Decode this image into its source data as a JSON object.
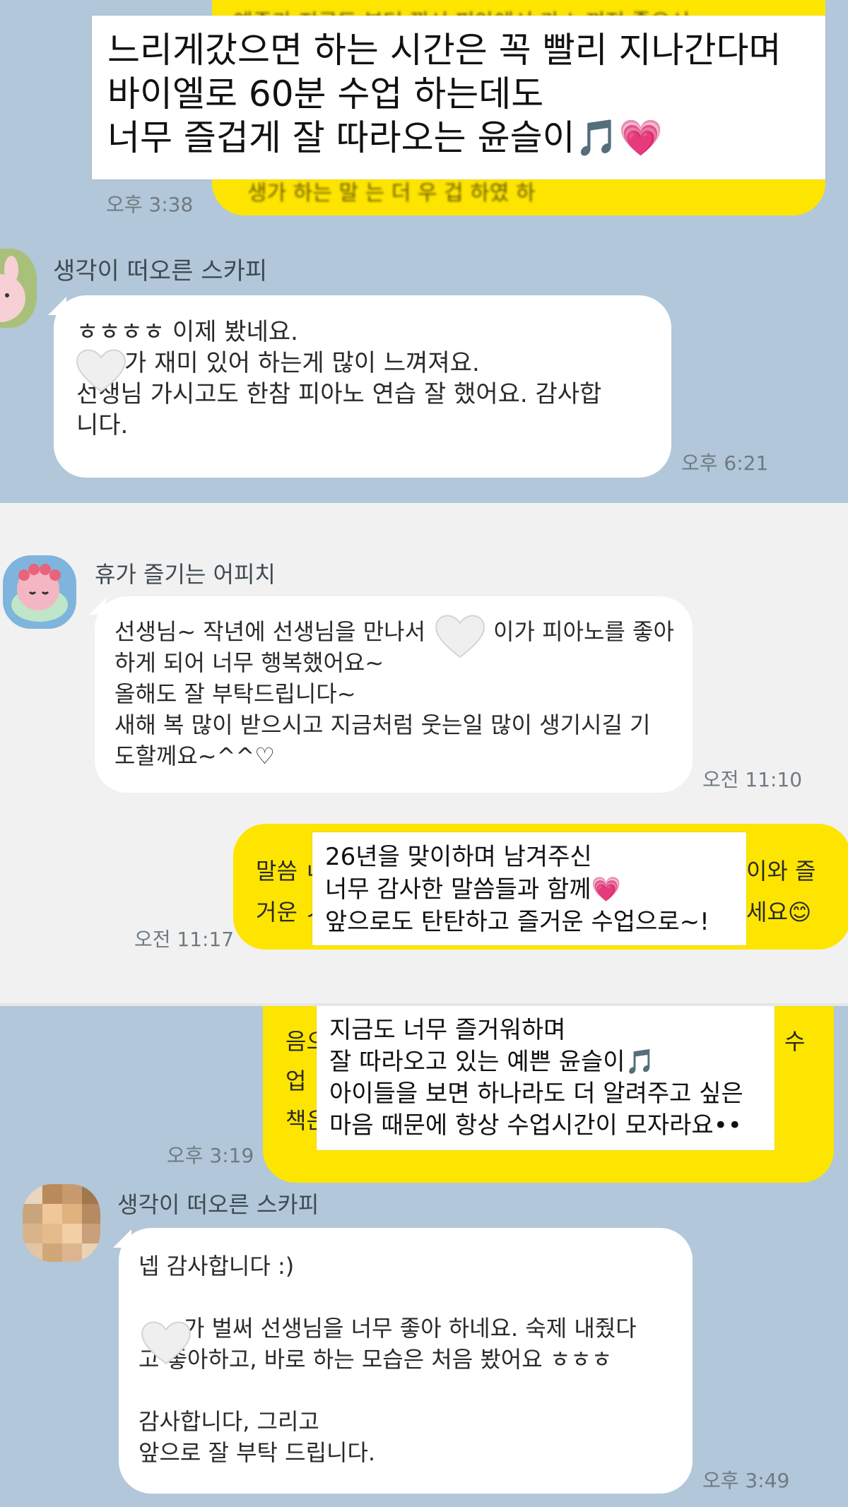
{
  "panel1": {
    "top_overlay": "느리게갔으면 하는 시간은 꼭 빨리 지나간다며\n바이엘로 60분 수업 하는데도\n너무 즐겁게 잘 따라오는 윤슬이🎵💗",
    "yellow_time": "오후 3:38",
    "sender": "생각이 떠오른 스카피",
    "message": "ㅎㅎㅎㅎ 이제 봤네요.\n　　가 재미 있어 하는게 많이 느껴져요.\n선생님 가시고도 한참 피아노 연습 잘 했어요. 감사합\n니다.",
    "time": "오후 6:21"
  },
  "panel2": {
    "sender": "휴가 즐기는 어피치",
    "message": "선생님~ 작년에 선생님을 만나서　　　이가 피아노를 좋아\n하게 되어 너무 행복했어요~\n올해도 잘 부탁드립니다~\n새해 복 많이 받으시고 지금처럼 웃는일 많이 생기시길 기\n도할께요~^^♡",
    "time": "오전 11:10",
    "reply_left": "말씀 ㄴ\n거운 ㅅ",
    "reply_right": "이와 즐\n세요😊",
    "reply_time": "오전 11:17",
    "overlay": "26년을 맞이하며 남겨주신\n너무 감사한 말씀들과 함께💗\n앞으로도 탄탄하고 즐거운 수업으로~!"
  },
  "panel3": {
    "reply_left": "음으\n업 !\n책은",
    "reply_right": "수",
    "reply_time": "오후 3:19",
    "overlay": "지금도 너무 즐거워하며\n잘 따라오고 있는 예쁜 윤슬이🎵\n아이들을 보면 하나라도 더 알려주고 싶은\n마음 때문에 항상 수업시간이 모자라요••",
    "sender": "생각이 떠오른 스카피",
    "message": "넵 감사합니다 :)\n\n　　가 벌써 선생님을 너무 좋아 하네요. 숙제 내줬다\n고 좋아하고, 바로 하는 모습은 처음 봤어요 ㅎㅎㅎ\n\n감사합니다, 그리고\n앞으로 잘 부탁 드립니다.",
    "time": "오후 3:49"
  },
  "icons": {
    "white_heart": "white-heart-emoji",
    "pink_heart": "pink-heart-emoji",
    "music_note": "music-notes-emoji",
    "smile": "smiling-face-emoji"
  },
  "colors": {
    "chat_bg": "#b2c7d9",
    "chat_bg_alt": "#f1f1f1",
    "my_bubble": "#fee500",
    "their_bubble": "#ffffff"
  }
}
